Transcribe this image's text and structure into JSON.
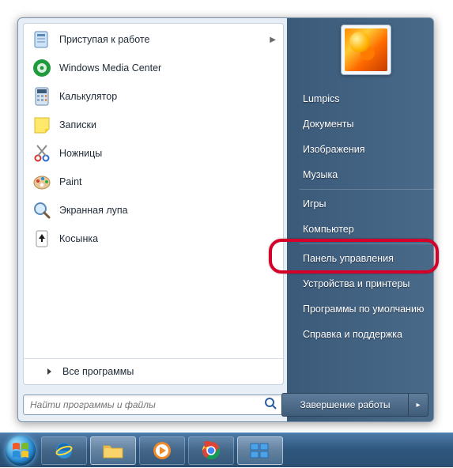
{
  "user": {
    "name": "Lumpics"
  },
  "programs": [
    {
      "label": "Приступая к работе",
      "icon": "getting-started-icon",
      "has_submenu": true
    },
    {
      "label": "Windows Media Center",
      "icon": "media-center-icon",
      "has_submenu": false
    },
    {
      "label": "Калькулятор",
      "icon": "calculator-icon",
      "has_submenu": false
    },
    {
      "label": "Записки",
      "icon": "sticky-notes-icon",
      "has_submenu": false
    },
    {
      "label": "Ножницы",
      "icon": "snipping-tool-icon",
      "has_submenu": false
    },
    {
      "label": "Paint",
      "icon": "paint-icon",
      "has_submenu": false
    },
    {
      "label": "Экранная лупа",
      "icon": "magnifier-icon",
      "has_submenu": false
    },
    {
      "label": "Косынка",
      "icon": "solitaire-icon",
      "has_submenu": false
    }
  ],
  "all_programs_label": "Все программы",
  "search": {
    "placeholder": "Найти программы и файлы"
  },
  "right_links": [
    "Lumpics",
    "Документы",
    "Изображения",
    "Музыка",
    "Игры",
    "Компьютер",
    "Панель управления",
    "Устройства и принтеры",
    "Программы по умолчанию",
    "Справка и поддержка"
  ],
  "highlighted_right_index": 6,
  "shutdown": {
    "label": "Завершение работы"
  }
}
